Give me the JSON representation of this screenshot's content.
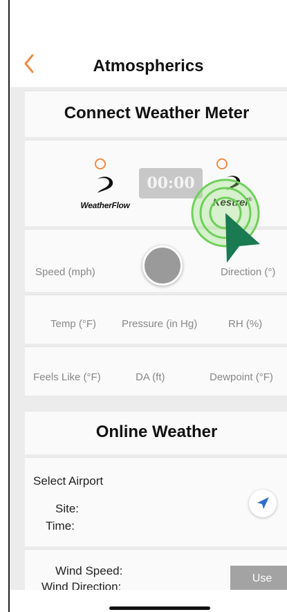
{
  "header": {
    "title": "Atmospherics"
  },
  "connect": {
    "heading": "Connect Weather Meter",
    "timer": "00:00",
    "weatherflow_label": "WeatherFlow",
    "kestrel_label": "Kestrel",
    "kestrel_mark": "®"
  },
  "readings": {
    "speed": "Speed (mph)",
    "direction": "Direction (°)",
    "temp": "Temp (°F)",
    "pressure": "Pressure (in Hg)",
    "rh": "RH (%)",
    "feels_like": "Feels Like (°F)",
    "da": "DA (ft)",
    "dewpoint": "Dewpoint (°F)"
  },
  "online": {
    "heading": "Online Weather",
    "select_airport": "Select Airport",
    "site_label": "Site:",
    "time_label": "Time:",
    "wind_speed_label": "Wind Speed:",
    "wind_direction_label": "Wind Direction:",
    "use_button": "Use"
  },
  "colors": {
    "accent": "#f08a42",
    "timer_bg": "#c8c8c8",
    "locate_blue": "#2f6fc8",
    "cursor_green": "#1a7a52",
    "ring_green": "#6ed05a"
  },
  "icons": {
    "back": "chevron-left-icon",
    "locate": "location-arrow-icon"
  }
}
